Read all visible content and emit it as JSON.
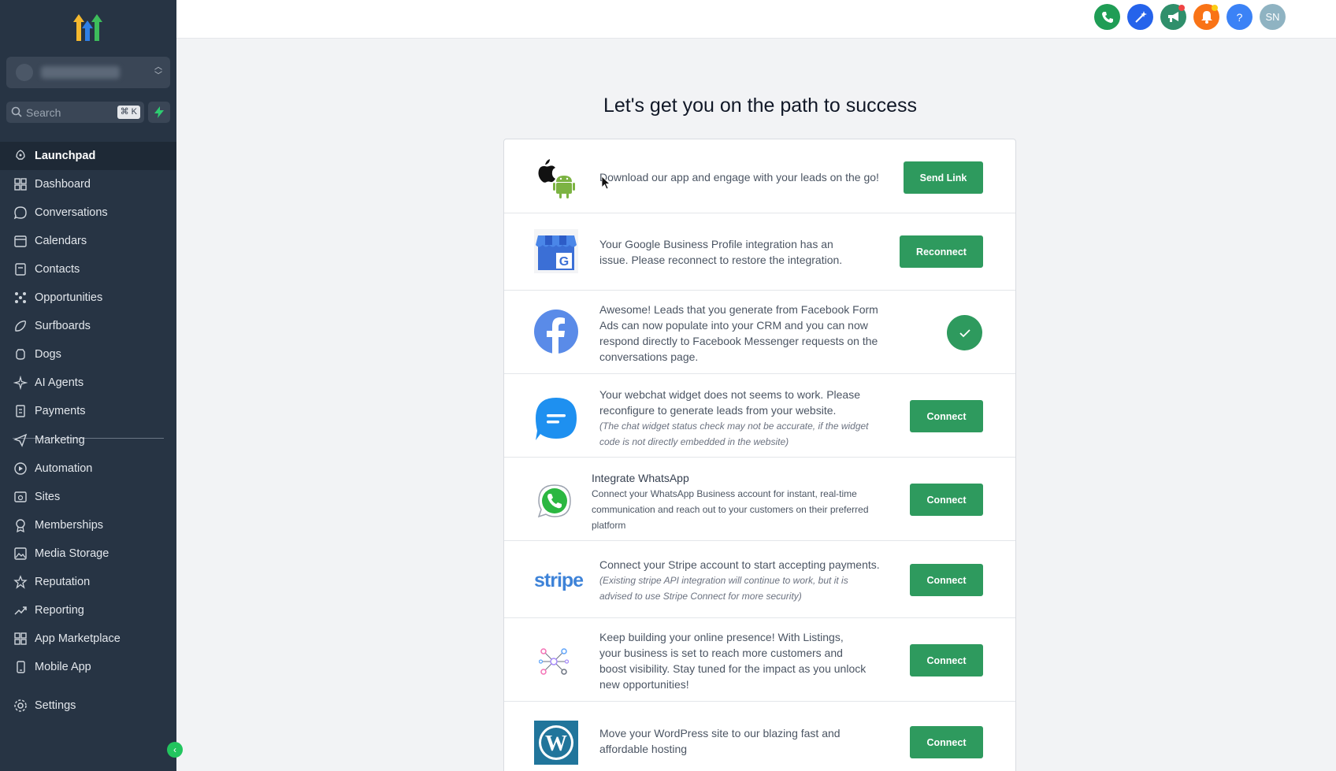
{
  "sidebar": {
    "search_placeholder": "Search",
    "search_shortcut": "⌘ K",
    "nav_primary": [
      {
        "label": "Launchpad",
        "icon": "rocket-icon",
        "active": true
      },
      {
        "label": "Dashboard",
        "icon": "grid-icon"
      },
      {
        "label": "Conversations",
        "icon": "chat-bubble-icon"
      },
      {
        "label": "Calendars",
        "icon": "calendar-icon"
      },
      {
        "label": "Contacts",
        "icon": "contact-book-icon"
      },
      {
        "label": "Opportunities",
        "icon": "pipeline-icon"
      },
      {
        "label": "Surfboards",
        "icon": "surfboard-icon"
      },
      {
        "label": "Dogs",
        "icon": "dog-icon"
      },
      {
        "label": "AI Agents",
        "icon": "sparkle-icon"
      },
      {
        "label": "Payments",
        "icon": "receipt-icon"
      }
    ],
    "nav_secondary": [
      {
        "label": "Marketing",
        "icon": "send-icon"
      },
      {
        "label": "Automation",
        "icon": "automation-icon"
      },
      {
        "label": "Sites",
        "icon": "sites-icon"
      },
      {
        "label": "Memberships",
        "icon": "award-icon"
      },
      {
        "label": "Media Storage",
        "icon": "image-icon"
      },
      {
        "label": "Reputation",
        "icon": "star-icon"
      },
      {
        "label": "Reporting",
        "icon": "trend-icon"
      },
      {
        "label": "App Marketplace",
        "icon": "apps-icon"
      },
      {
        "label": "Mobile App",
        "icon": "mobile-icon"
      }
    ],
    "settings_label": "Settings"
  },
  "topbar": {
    "avatar_initials": "SN",
    "help_label": "?",
    "colors": {
      "phone": "#1f9d55",
      "magic": "#2563eb",
      "announce": "#2f8f6b",
      "bell": "#f97316",
      "help": "#3b82f6",
      "avatar": "#8fb3c2"
    }
  },
  "main": {
    "heading": "Let's get you on the path to success",
    "rows": [
      {
        "icon": "apple-android-icon",
        "text": "Download our app and engage with your leads on the go!",
        "button": "Send Link"
      },
      {
        "icon": "google-business-icon",
        "text": "Your Google Business Profile integration has an issue. Please reconnect to restore the integration.",
        "button": "Reconnect"
      },
      {
        "icon": "facebook-icon",
        "text": "Awesome! Leads that you generate from Facebook Form Ads can now populate into your CRM and you can now respond directly to Facebook Messenger requests on the conversations page.",
        "status": "connected"
      },
      {
        "icon": "webchat-icon",
        "text": "Your webchat widget does not seems to work. Please reconfigure to generate leads from your website.",
        "note": "(The chat widget status check may not be accurate, if the widget code is not directly embedded in the website)",
        "button": "Connect"
      },
      {
        "icon": "whatsapp-icon",
        "title": "Integrate WhatsApp",
        "text": "Connect your WhatsApp Business account for instant, real-time communication and reach out to your customers on their preferred platform",
        "button": "Connect"
      },
      {
        "icon": "stripe-logo",
        "logo_text": "stripe",
        "text": "Connect your Stripe account to start accepting payments.",
        "note": "(Existing stripe API integration will continue to work, but it is advised to use Stripe Connect for more security)",
        "button": "Connect"
      },
      {
        "icon": "listings-network-icon",
        "text": "Keep building your online presence! With Listings, your business is set to reach more customers and boost visibility. Stay tuned for the impact as you unlock new opportunities!",
        "button": "Connect"
      },
      {
        "icon": "wordpress-icon",
        "text": "Move your WordPress site to our blazing fast and affordable hosting",
        "button": "Connect"
      }
    ]
  }
}
